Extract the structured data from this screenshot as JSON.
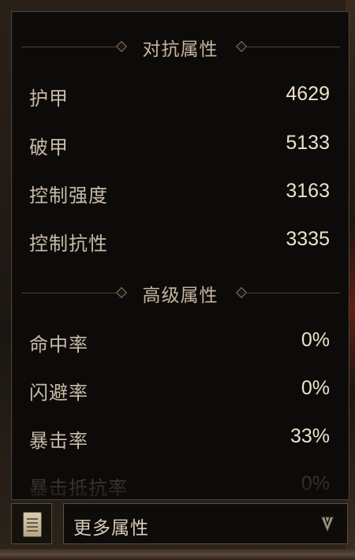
{
  "sections": [
    {
      "title": "对抗属性",
      "stats": [
        {
          "label": "护甲",
          "value": "4629"
        },
        {
          "label": "破甲",
          "value": "5133"
        },
        {
          "label": "控制强度",
          "value": "3163"
        },
        {
          "label": "控制抗性",
          "value": "3335"
        }
      ]
    },
    {
      "title": "高级属性",
      "stats": [
        {
          "label": "命中率",
          "value": "0%"
        },
        {
          "label": "闪避率",
          "value": "0%"
        },
        {
          "label": "暴击率",
          "value": "33%"
        },
        {
          "label": "暴击抵抗率",
          "value": "0%"
        }
      ]
    }
  ],
  "footer": {
    "dropdown_label": "更多属性",
    "scroll_icon": "scroll-icon",
    "arrow_icon": "chevron-down-icon"
  },
  "colors": {
    "panel_bg": "#0d0b09",
    "label_text": "#c7bba9",
    "value_text": "#ece1cb",
    "header_text": "#c6b4a0",
    "border": "#5a4d40"
  }
}
